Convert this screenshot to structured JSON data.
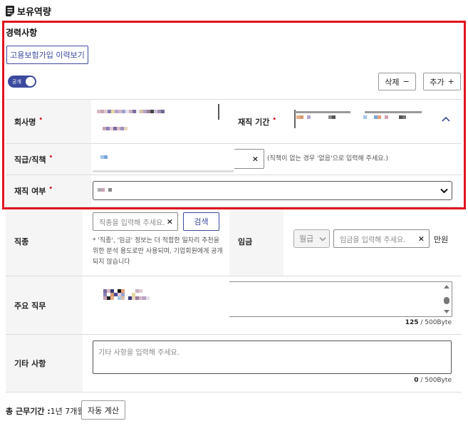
{
  "header": {
    "title": "보유역량",
    "icon": "document-icon"
  },
  "section": {
    "title": "경력사항"
  },
  "buttons": {
    "insurance_history": "고용보험가입 이력보기",
    "delete": "삭제",
    "delete_symbol": "−",
    "add": "추가",
    "add_symbol": "+",
    "search": "검색",
    "auto_calc": "자동 계산"
  },
  "toggle": {
    "label": "공개",
    "on": true
  },
  "labels": {
    "company": "회사명",
    "period": "재직 기간",
    "position": "직급/직책",
    "employed": "재직 여부",
    "job_type": "직종",
    "salary": "임금",
    "main_duty": "주요 직무",
    "other": "기타 사항",
    "total_label": "총 근무기간 :",
    "total_value": "1년 7개월"
  },
  "required_mark": "•",
  "position_hint": "(직책이 없는 경우 '없음'으로 입력해 주세요.)",
  "job_type": {
    "placeholder": "직종을 입력해 주세요.",
    "note": "* '직종', '임금' 정보는 더 적합한 일자리 추천을 위한 분석 용도로만 사용되며, 기업회원에게 공개되지 않습니다"
  },
  "salary": {
    "period_option": "월급",
    "placeholder": "임금을 입력해 주세요.",
    "unit": "만원"
  },
  "main_duty": {
    "counter_value": "125",
    "counter_max": " / 500Byte"
  },
  "other": {
    "placeholder": "기타 사항을 입력해 주세요.",
    "counter_value": "0",
    "counter_max": " / 500Byte"
  },
  "clear_symbol": "×",
  "colors": {
    "accent": "#3c4a9e",
    "highlight": "#e0141e",
    "required": "#d21e2a"
  }
}
